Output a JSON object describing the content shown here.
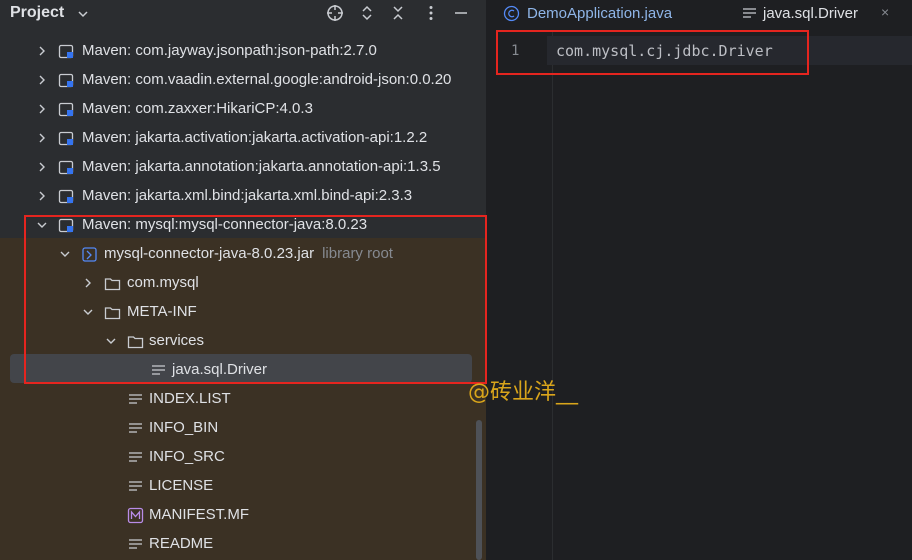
{
  "project_panel": {
    "title": "Project",
    "title_icon": "chevron-down-icon",
    "header_icons": [
      "crosshair-icon",
      "expand-all-icon",
      "collapse-all-icon",
      "more-vertical-icon",
      "minimize-icon"
    ]
  },
  "tree": {
    "rows": [
      {
        "label": "Maven: com.jayway.jsonpath:json-path:2.7.0",
        "icon": "library-icon",
        "expanded": false
      },
      {
        "label": "Maven: com.vaadin.external.google:android-json:0.0.20",
        "icon": "library-icon",
        "expanded": false
      },
      {
        "label": "Maven: com.zaxxer:HikariCP:4.0.3",
        "icon": "library-icon",
        "expanded": false
      },
      {
        "label": "Maven: jakarta.activation:jakarta.activation-api:1.2.2",
        "icon": "library-icon",
        "expanded": false
      },
      {
        "label": "Maven: jakarta.annotation:jakarta.annotation-api:1.3.5",
        "icon": "library-icon",
        "expanded": false
      },
      {
        "label": "Maven: jakarta.xml.bind:jakarta.xml.bind-api:2.3.3",
        "icon": "library-icon",
        "expanded": false
      },
      {
        "label": "Maven: mysql:mysql-connector-java:8.0.23",
        "icon": "library-icon",
        "expanded": true
      },
      {
        "label": "mysql-connector-java-8.0.23.jar",
        "hint": "library root",
        "icon": "jar-icon",
        "expanded": true
      },
      {
        "label": "com.mysql",
        "icon": "folder-icon",
        "expanded": false
      },
      {
        "label": "META-INF",
        "icon": "folder-icon",
        "expanded": true
      },
      {
        "label": "services",
        "icon": "folder-icon",
        "expanded": true
      },
      {
        "label": "java.sql.Driver",
        "icon": "text-file-icon",
        "selected": true
      },
      {
        "label": "INDEX.LIST",
        "icon": "text-file-icon"
      },
      {
        "label": "INFO_BIN",
        "icon": "text-file-icon"
      },
      {
        "label": "INFO_SRC",
        "icon": "text-file-icon"
      },
      {
        "label": "LICENSE",
        "icon": "text-file-icon"
      },
      {
        "label": "MANIFEST.MF",
        "icon": "manifest-icon"
      },
      {
        "label": "README",
        "icon": "text-file-icon"
      }
    ]
  },
  "watermark": "@砖业洋__",
  "editor": {
    "tabs": [
      {
        "label": "DemoApplication.java",
        "icon": "class-icon",
        "active": false
      },
      {
        "label": "java.sql.Driver",
        "icon": "text-file-icon",
        "active": true
      }
    ],
    "close_glyph": "×",
    "line_number": "1",
    "code": "com.mysql.cj.jdbc.Driver"
  },
  "colors": {
    "panel_bg": "#2b2d30",
    "editor_bg": "#1e1f22",
    "tint_bg": "#3b3124",
    "annotation_red": "#e5251f",
    "watermark": "#d9a51b"
  }
}
